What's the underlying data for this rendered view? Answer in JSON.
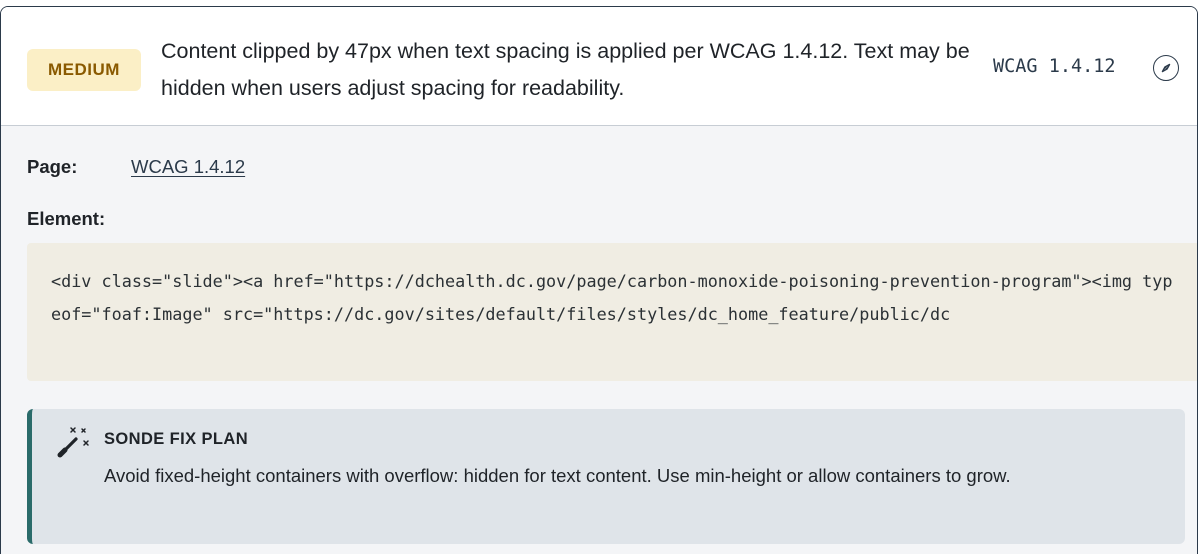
{
  "issue": {
    "severity": "MEDIUM",
    "description": "Content clipped by 47px when text spacing is applied per WCAG 1.4.12. Text may be hidden when users adjust spacing for readability.",
    "wcag_ref": "WCAG 1.4.12",
    "action_icon": "compass-icon"
  },
  "details": {
    "page_label": "Page:",
    "page_link": "WCAG 1.4.12",
    "element_label": "Element:",
    "element_code": "<div class=\"slide\"><a href=\"https://dchealth.dc.gov/page/carbon-monoxide-poisoning-prevention-program\"><img typeof=\"foaf:Image\" src=\"https://dc.gov/sites/default/files/styles/dc_home_feature/public/dc"
  },
  "fix_plan": {
    "icon": "magic-wand-icon",
    "title": "SONDE FIX PLAN",
    "text": "Avoid fixed-height containers with overflow: hidden for text content. Use min-height or allow containers to grow."
  },
  "colors": {
    "badge_bg": "#fbefc6",
    "badge_text": "#8a5a00",
    "accent": "#2a6b6a",
    "code_bg": "#f0ede3",
    "panel_bg": "#dfe4e9"
  }
}
